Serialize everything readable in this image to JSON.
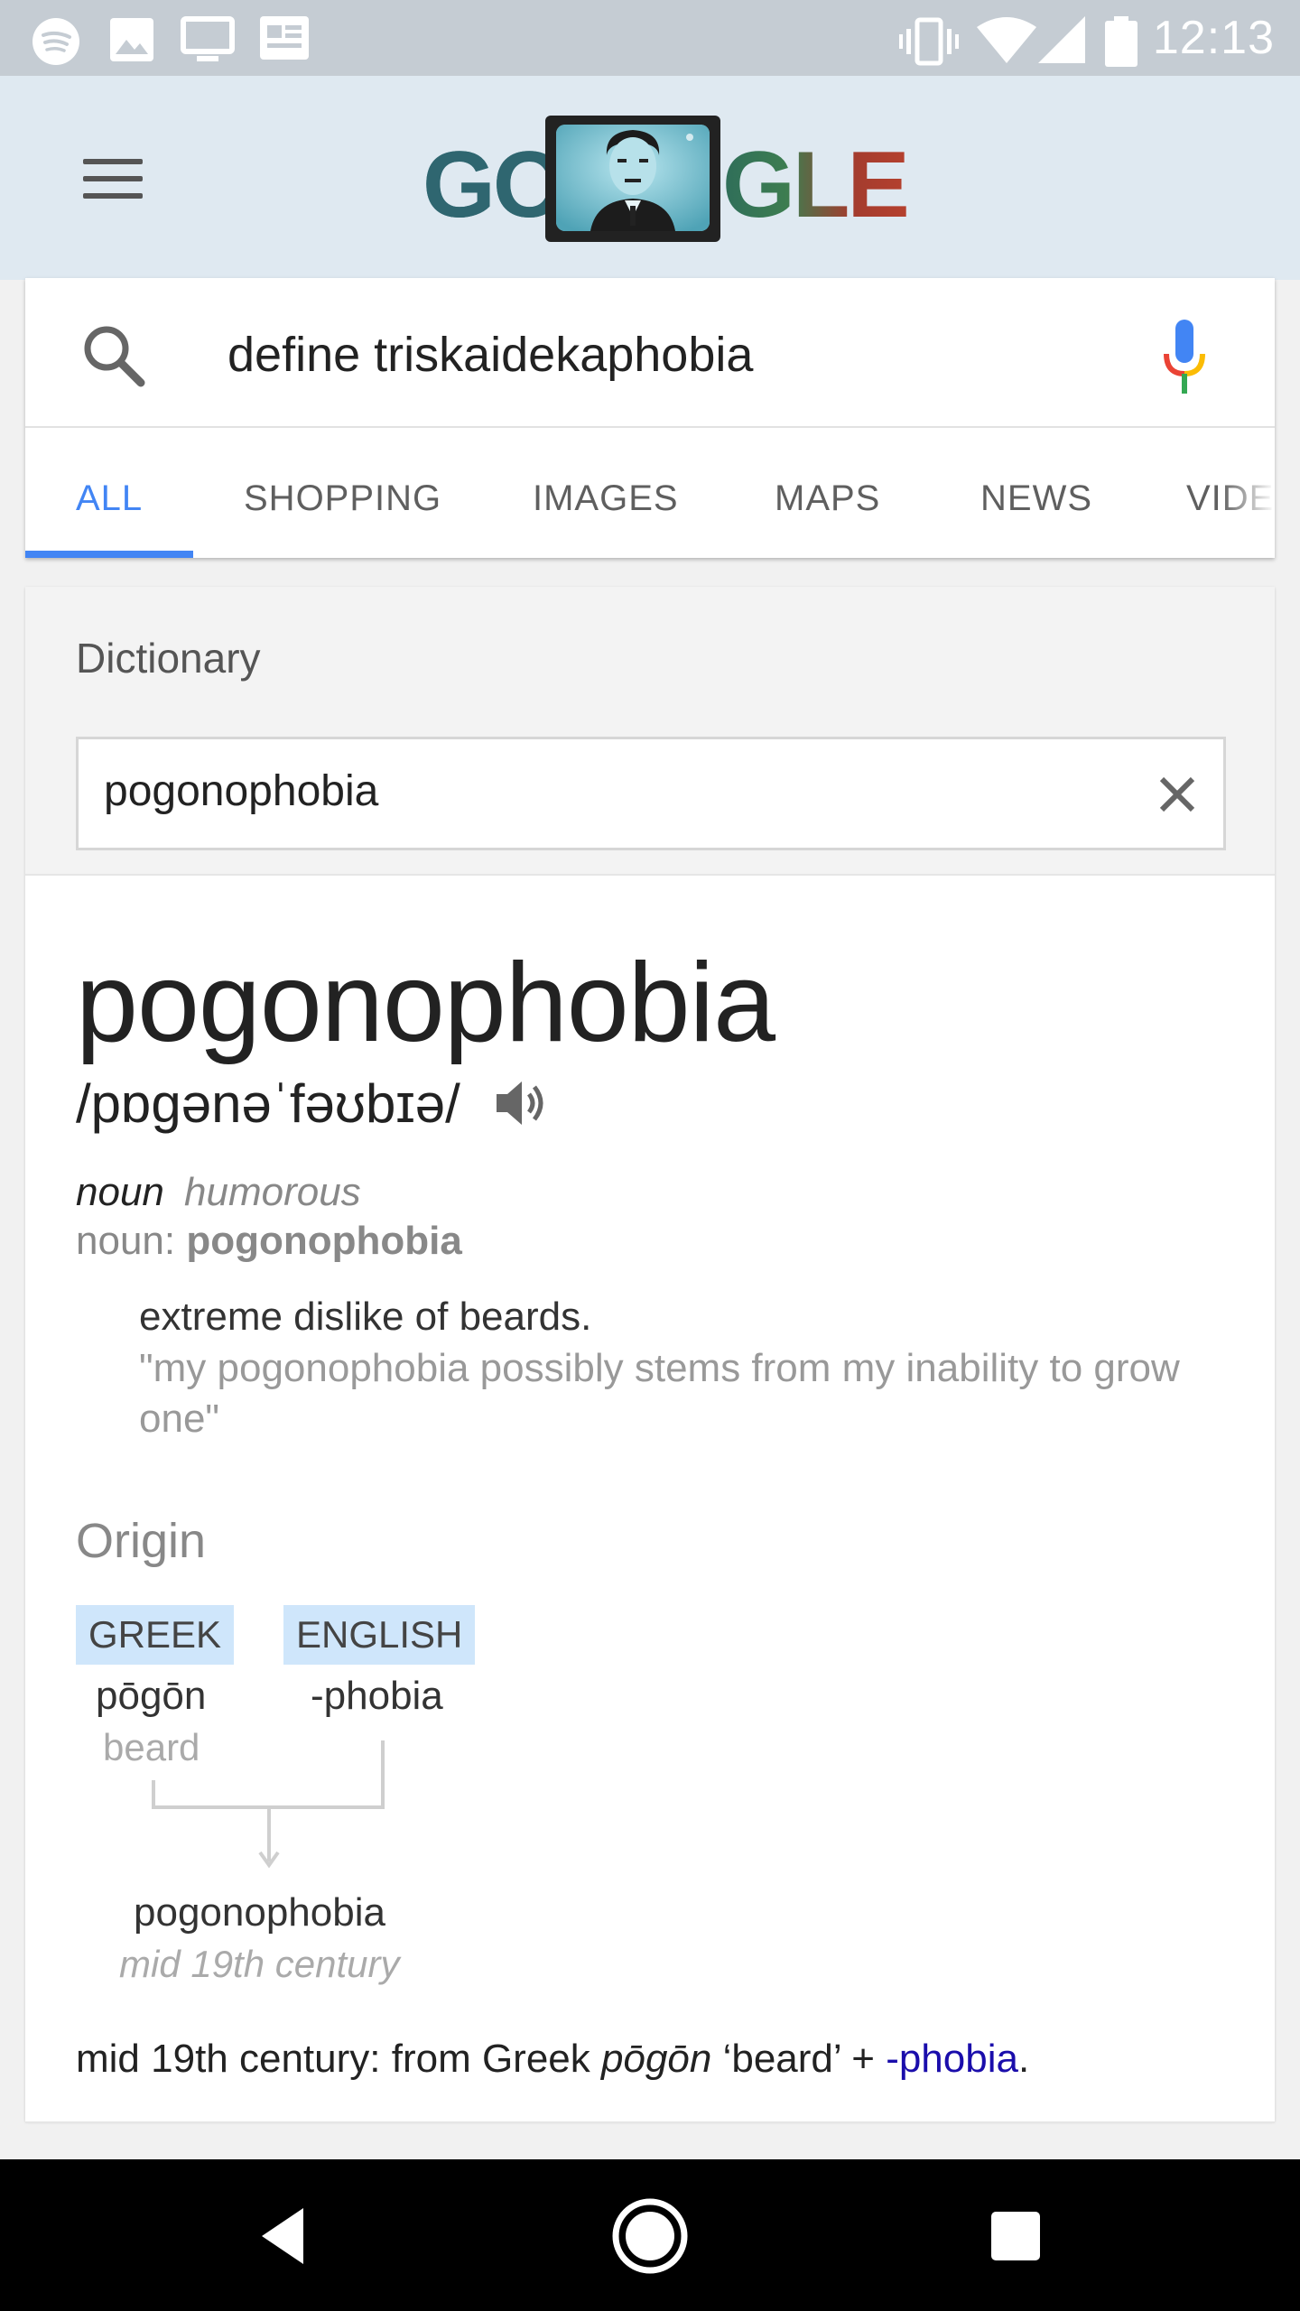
{
  "status_bar": {
    "time": "12:13",
    "left_icons": [
      "spotify-icon",
      "image-icon",
      "cast-icon",
      "news-icon"
    ],
    "right_icons": [
      "vibrate-icon",
      "wifi-icon",
      "signal-icon",
      "battery-icon"
    ]
  },
  "header": {
    "logo_left": "GO",
    "logo_right": "GLE"
  },
  "search": {
    "query": "define triskaidekaphobia"
  },
  "tabs": [
    {
      "label": "ALL",
      "active": true
    },
    {
      "label": "SHOPPING",
      "active": false
    },
    {
      "label": "IMAGES",
      "active": false
    },
    {
      "label": "MAPS",
      "active": false
    },
    {
      "label": "NEWS",
      "active": false
    },
    {
      "label": "VIDE",
      "active": false
    }
  ],
  "dictionary": {
    "label": "Dictionary",
    "input_value": "pogonophobia",
    "headword": "pogonophobia",
    "pronunciation": "/pɒɡənəˈfəʊbɪə/",
    "part_of_speech": "noun",
    "register": "humorous",
    "noun_prefix": "noun:",
    "noun_word": "pogonophobia",
    "definition": "extreme dislike of beards.",
    "example": "\"my pogonophobia possibly stems from my inability to grow one\"",
    "origin": {
      "title": "Origin",
      "sources": [
        {
          "language": "GREEK",
          "word": "pōgōn",
          "gloss": "beard"
        },
        {
          "language": "ENGLISH",
          "word": "-phobia",
          "gloss": ""
        }
      ],
      "result_word": "pogonophobia",
      "result_date": "mid 19th century",
      "summary_prefix": "mid 19th century: from Greek ",
      "summary_italic": "pōgōn",
      "summary_mid": " ‘beard’ + ",
      "summary_link": "-phobia",
      "summary_end": "."
    }
  },
  "colors": {
    "accent": "#4285f4",
    "link": "#1a0dab",
    "tag_bg": "#cfe6fb",
    "header_bg": "#dfe9f1",
    "status_bar_bg": "#c5ccd3"
  }
}
